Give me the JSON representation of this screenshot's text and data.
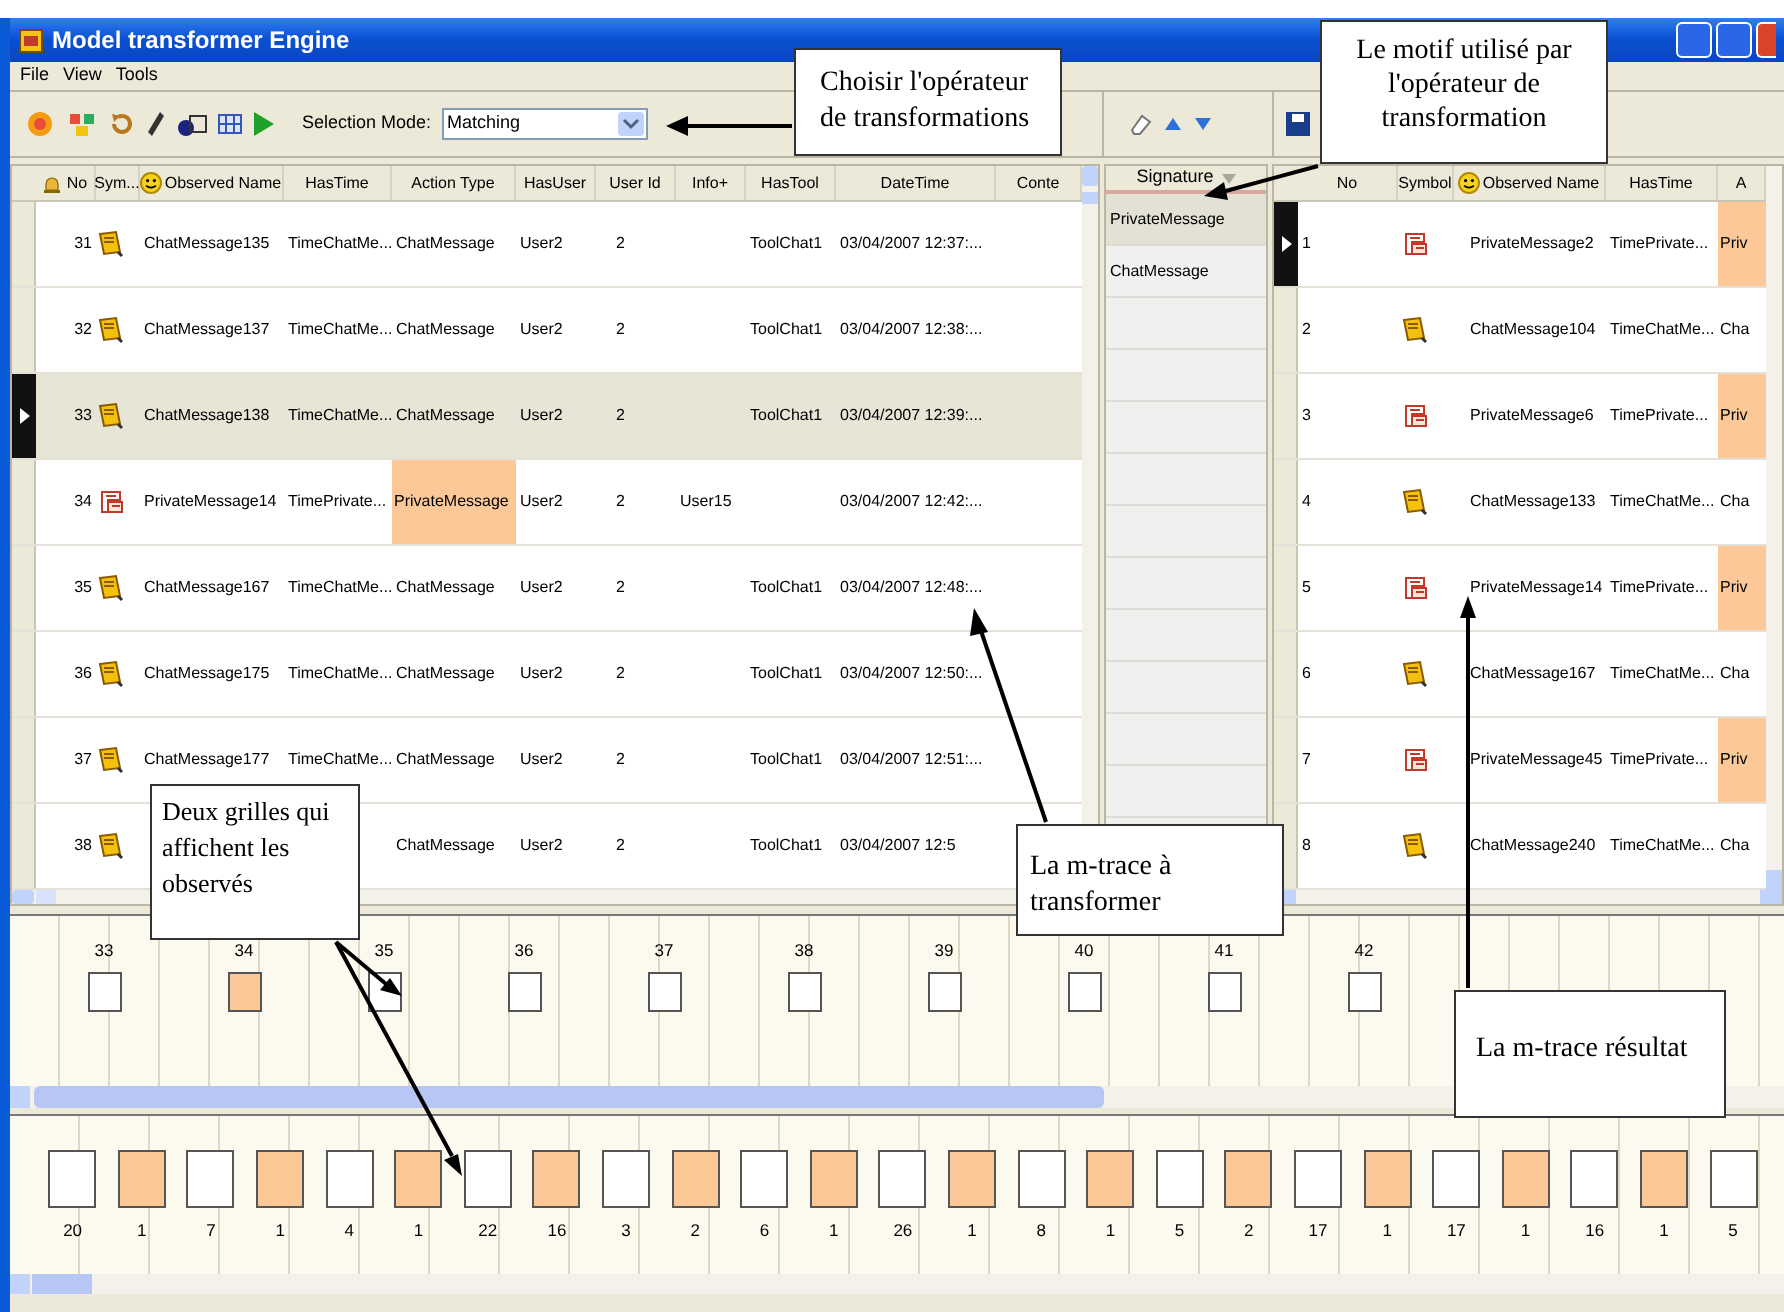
{
  "window": {
    "title": "Model transformer Engine"
  },
  "menu": [
    "File",
    "View",
    "Tools"
  ],
  "toolbar": {
    "selection_mode_label": "Selection Mode:",
    "selection_mode": "Matching"
  },
  "source_grid": {
    "columns": [
      "No",
      "Sym...",
      "Observed Name",
      "HasTime",
      "Action Type",
      "HasUser",
      "User Id",
      "Info+",
      "HasTool",
      "DateTime",
      "Conte"
    ],
    "rows": [
      {
        "no": "31",
        "kind": "chat",
        "name": "ChatMessage135",
        "has_time": "TimeChatMe...",
        "action_type": "ChatMessage",
        "highlighted": false,
        "has_user": "User2",
        "user_id": "2",
        "has_tool": "ToolChat1",
        "date_time": "03/04/2007 12:37:...",
        "selected": false
      },
      {
        "no": "32",
        "kind": "chat",
        "name": "ChatMessage137",
        "has_time": "TimeChatMe...",
        "action_type": "ChatMessage",
        "highlighted": false,
        "has_user": "User2",
        "user_id": "2",
        "has_tool": "ToolChat1",
        "date_time": "03/04/2007 12:38:...",
        "selected": false
      },
      {
        "no": "33",
        "kind": "chat",
        "name": "ChatMessage138",
        "has_time": "TimeChatMe...",
        "action_type": "ChatMessage",
        "highlighted": false,
        "has_user": "User2",
        "user_id": "2",
        "has_tool": "ToolChat1",
        "date_time": "03/04/2007 12:39:...",
        "selected": true
      },
      {
        "no": "34",
        "kind": "private",
        "name": "PrivateMessage14",
        "has_time": "TimePrivate...",
        "action_type": "PrivateMessage",
        "highlighted": true,
        "has_user": "User2",
        "user_id": "2",
        "info": "User15",
        "date_time": "03/04/2007 12:42:...",
        "selected": false
      },
      {
        "no": "35",
        "kind": "chat",
        "name": "ChatMessage167",
        "has_time": "TimeChatMe...",
        "action_type": "ChatMessage",
        "highlighted": false,
        "has_user": "User2",
        "user_id": "2",
        "has_tool": "ToolChat1",
        "date_time": "03/04/2007 12:48:...",
        "selected": false
      },
      {
        "no": "36",
        "kind": "chat",
        "name": "ChatMessage175",
        "has_time": "TimeChatMe...",
        "action_type": "ChatMessage",
        "highlighted": false,
        "has_user": "User2",
        "user_id": "2",
        "has_tool": "ToolChat1",
        "date_time": "03/04/2007 12:50:...",
        "selected": false
      },
      {
        "no": "37",
        "kind": "chat",
        "name": "ChatMessage177",
        "has_time": "TimeChatMe...",
        "action_type": "ChatMessage",
        "highlighted": false,
        "has_user": "User2",
        "user_id": "2",
        "has_tool": "ToolChat1",
        "date_time": "03/04/2007 12:51:...",
        "selected": false
      },
      {
        "no": "38",
        "kind": "chat",
        "action_type": "ChatMessage",
        "highlighted": false,
        "has_user": "User2",
        "user_id": "2",
        "has_tool": "ToolChat1",
        "date_time": "03/04/2007 12:5",
        "selected": false
      }
    ]
  },
  "signature": {
    "header": "Signature",
    "items": [
      {
        "label": "PrivateMessage",
        "selected": true
      },
      {
        "label": "ChatMessage",
        "selected": false
      }
    ]
  },
  "result_grid": {
    "columns": [
      "No",
      "Symbol",
      "Observed Name",
      "HasTime",
      "A"
    ],
    "rows": [
      {
        "no": "1",
        "kind": "private",
        "name": "PrivateMessage2",
        "has_time": "TimePrivate...",
        "action": "Priv",
        "highlighted": true,
        "selected": true
      },
      {
        "no": "2",
        "kind": "chat",
        "name": "ChatMessage104",
        "has_time": "TimeChatMe...",
        "action": "Cha",
        "highlighted": false,
        "selected": false
      },
      {
        "no": "3",
        "kind": "private",
        "name": "PrivateMessage6",
        "has_time": "TimePrivate...",
        "action": "Priv",
        "highlighted": true,
        "selected": false
      },
      {
        "no": "4",
        "kind": "chat",
        "name": "ChatMessage133",
        "has_time": "TimeChatMe...",
        "action": "Cha",
        "highlighted": false,
        "selected": false
      },
      {
        "no": "5",
        "kind": "private",
        "name": "PrivateMessage14",
        "has_time": "TimePrivate...",
        "action": "Priv",
        "highlighted": true,
        "selected": false
      },
      {
        "no": "6",
        "kind": "chat",
        "name": "ChatMessage167",
        "has_time": "TimeChatMe...",
        "action": "Cha",
        "highlighted": false,
        "selected": false
      },
      {
        "no": "7",
        "kind": "private",
        "name": "PrivateMessage45",
        "has_time": "TimePrivate...",
        "action": "Priv",
        "highlighted": true,
        "selected": false
      },
      {
        "no": "8",
        "kind": "chat",
        "name": "ChatMessage240",
        "has_time": "TimeChatMe...",
        "action": "Cha",
        "highlighted": false,
        "selected": false
      }
    ]
  },
  "source_timeline": {
    "items": [
      {
        "label": "33",
        "highlighted": false
      },
      {
        "label": "34",
        "highlighted": true
      },
      {
        "label": "35",
        "highlighted": false
      },
      {
        "label": "36",
        "highlighted": false
      },
      {
        "label": "37",
        "highlighted": false
      },
      {
        "label": "38",
        "highlighted": false
      },
      {
        "label": "39",
        "highlighted": false
      },
      {
        "label": "40",
        "highlighted": false
      },
      {
        "label": "41",
        "highlighted": false
      },
      {
        "label": "42",
        "highlighted": false
      }
    ]
  },
  "result_timeline": {
    "items": [
      {
        "label": "20",
        "highlighted": false
      },
      {
        "label": "1",
        "highlighted": true
      },
      {
        "label": "7",
        "highlighted": false
      },
      {
        "label": "1",
        "highlighted": true
      },
      {
        "label": "4",
        "highlighted": false
      },
      {
        "label": "1",
        "highlighted": true
      },
      {
        "label": "22",
        "highlighted": false
      },
      {
        "label": "16",
        "highlighted": true
      },
      {
        "label": "3",
        "highlighted": false
      },
      {
        "label": "2",
        "highlighted": true
      },
      {
        "label": "6",
        "highlighted": false
      },
      {
        "label": "1",
        "highlighted": true
      },
      {
        "label": "26",
        "highlighted": false
      },
      {
        "label": "1",
        "highlighted": true
      },
      {
        "label": "8",
        "highlighted": false
      },
      {
        "label": "1",
        "highlighted": true
      },
      {
        "label": "5",
        "highlighted": false
      },
      {
        "label": "2",
        "highlighted": true
      },
      {
        "label": "17",
        "highlighted": false
      },
      {
        "label": "1",
        "highlighted": true
      },
      {
        "label": "17",
        "highlighted": false
      },
      {
        "label": "1",
        "highlighted": true
      },
      {
        "label": "16",
        "highlighted": false
      },
      {
        "label": "1",
        "highlighted": true
      },
      {
        "label": "5",
        "highlighted": false
      }
    ]
  },
  "callouts": [
    {
      "text": "Choisir l'opérateur de transformations"
    },
    {
      "text": "Le motif utilisé par l'opérateur de transformation"
    },
    {
      "text": "La m-trace à transformer"
    },
    {
      "text": "Deux grilles qui affichent les observés"
    },
    {
      "text": "La m-trace résultat"
    }
  ]
}
